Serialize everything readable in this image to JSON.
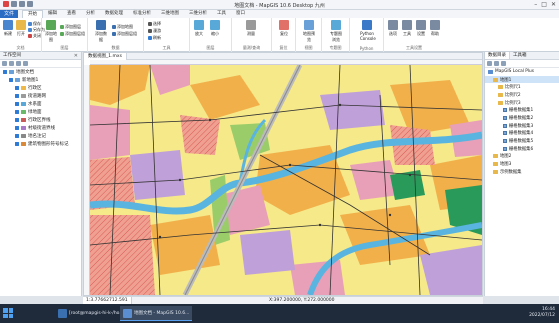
{
  "window": {
    "title": "地图文档 - MapGIS 10.6 Desktop 九州"
  },
  "menu": {
    "file": "文件",
    "tabs": [
      "开始",
      "编辑",
      "查看",
      "分析",
      "数据处理",
      "标准分析",
      "三维地图",
      "三维分析",
      "工具",
      "窗口"
    ]
  },
  "ribbon": {
    "groups": [
      {
        "label": "文档",
        "buttons": [
          "新建",
          "打开",
          "保存",
          "另存为",
          "关闭"
        ]
      },
      {
        "label": "图层",
        "buttons": [
          "添加地图",
          "添加图层",
          "添加图层组"
        ]
      },
      {
        "label": "数据",
        "buttons": [
          "添加数据",
          "添加地图",
          "添加图层组"
        ]
      },
      {
        "label": "工具",
        "buttons": [
          "选择",
          "漫游",
          "刷新"
        ]
      },
      {
        "label": "图层",
        "buttons": [
          "放大",
          "缩小"
        ]
      },
      {
        "label": "量测/查询",
        "buttons": [
          "测量"
        ]
      },
      {
        "label": "复位",
        "buttons": [
          "复位"
        ]
      },
      {
        "label": "视图",
        "buttons": [
          "地图预览"
        ]
      },
      {
        "label": "专题图",
        "buttons": [
          "专题图浏览"
        ]
      },
      {
        "label": "Python",
        "buttons": [
          "Python Console"
        ]
      },
      {
        "label": "工具设置",
        "buttons": [
          "选项",
          "工具",
          "设置",
          "帮助"
        ]
      }
    ]
  },
  "left_panel": {
    "title": "工作空间",
    "items": [
      {
        "label": "地图文档",
        "level": 0,
        "color": "#6aa0d8"
      },
      {
        "label": "新地图1",
        "level": 1,
        "color": "#6aa0d8"
      },
      {
        "label": "行政区",
        "level": 2,
        "color": "#f0b848"
      },
      {
        "label": "街道路网",
        "level": 2,
        "color": "#9a9a9a"
      },
      {
        "label": "水系面",
        "level": 2,
        "color": "#5aa8d8"
      },
      {
        "label": "绿地面",
        "level": 2,
        "color": "#6ab86a"
      },
      {
        "label": "行政区界线",
        "level": 2,
        "color": "#c85a5a"
      },
      {
        "label": "村级街道界线",
        "level": 2,
        "color": "#a87ac8"
      },
      {
        "label": "地名注记",
        "level": 2,
        "color": "#888888"
      },
      {
        "label": "建筑物图形符号标记",
        "level": 2,
        "color": "#d88a3a"
      }
    ]
  },
  "document_tab": {
    "label": "数据视图_1.mxs"
  },
  "right_panel": {
    "tabs": [
      "数据目录",
      "工具箱"
    ],
    "items": [
      {
        "label": "MapGIS Local Plus",
        "level": 0,
        "type": "root"
      },
      {
        "label": "地图1",
        "level": 1,
        "type": "folder",
        "selected": true
      },
      {
        "label": "比例尺1",
        "level": 2,
        "type": "folder"
      },
      {
        "label": "比例尺2",
        "level": 2,
        "type": "folder"
      },
      {
        "label": "比例尺3",
        "level": 2,
        "type": "folder"
      },
      {
        "label": "栅格数据集1",
        "level": 3,
        "type": "map"
      },
      {
        "label": "栅格数据集2",
        "level": 3,
        "type": "map"
      },
      {
        "label": "栅格数据集3",
        "level": 3,
        "type": "map"
      },
      {
        "label": "栅格数据集4",
        "level": 3,
        "type": "map"
      },
      {
        "label": "栅格数据集5",
        "level": 3,
        "type": "map"
      },
      {
        "label": "栅格数据集6",
        "level": 3,
        "type": "map"
      },
      {
        "label": "地图2",
        "level": 1,
        "type": "folder"
      },
      {
        "label": "地图3",
        "level": 1,
        "type": "folder"
      },
      {
        "label": "示例数据集",
        "level": 1,
        "type": "folder"
      }
    ]
  },
  "status": {
    "scale": "1:3.77662712.591",
    "coordinates": "X:397.200000, Y:272.000000"
  },
  "taskbar": {
    "apps": [
      {
        "label": "[root@mapgis-hi-k-/ho...",
        "active": false,
        "color": "#3a6fb0"
      },
      {
        "label": "地图文档 - MapGIS 10.6...",
        "active": true,
        "color": "#5a8ed0"
      }
    ],
    "time": "16:44",
    "date": "2022/07/12"
  },
  "colors": {
    "accent": "#2b6cc4",
    "map_land": "#f5e98a",
    "map_orange": "#f2b04a",
    "map_pink": "#e8a0b8",
    "map_purple": "#c0a0d8",
    "map_water": "#5ab4e0",
    "map_green": "#2a9a5a",
    "map_red": "#e07068"
  }
}
